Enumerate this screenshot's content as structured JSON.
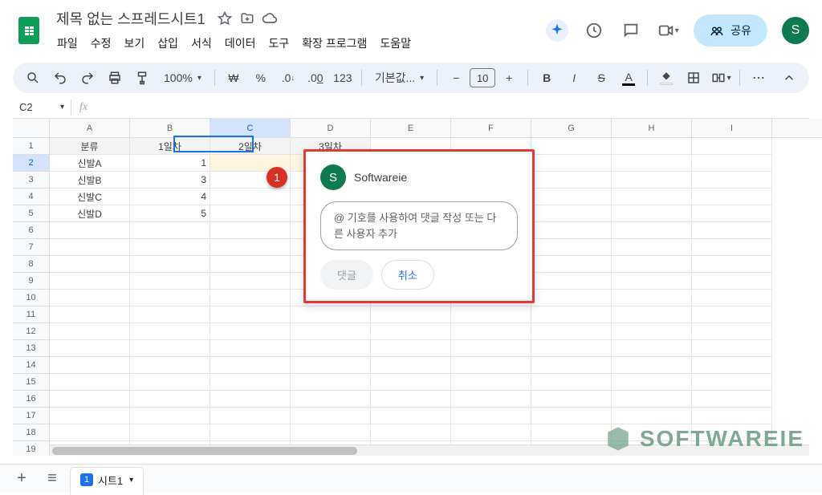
{
  "header": {
    "doc_title": "제목 없는 스프레드시트1",
    "menus": [
      "파일",
      "수정",
      "보기",
      "삽입",
      "서식",
      "데이터",
      "도구",
      "확장 프로그램",
      "도움말"
    ],
    "share_label": "공유",
    "avatar_letter": "S"
  },
  "toolbar": {
    "zoom": "100%",
    "currency": "₩",
    "percent": "%",
    "dec_dec": ".0",
    "inc_dec": ".00",
    "num_fmt": "123",
    "font": "기본값...",
    "font_size": "10"
  },
  "formula_bar": {
    "cell_ref": "C2",
    "fx": "fx",
    "value": ""
  },
  "columns": [
    "A",
    "B",
    "C",
    "D",
    "E",
    "F",
    "G",
    "H",
    "I"
  ],
  "selected_col_index": 2,
  "selected_row_index": 1,
  "row_count": 19,
  "data": [
    [
      "분류",
      "1일차",
      "2일차",
      "3일차"
    ],
    [
      "신발A",
      "1",
      "",
      ""
    ],
    [
      "신발B",
      "3",
      "",
      ""
    ],
    [
      "신발C",
      "4",
      "",
      ""
    ],
    [
      "신발D",
      "5",
      "",
      ""
    ]
  ],
  "comment": {
    "author": "Softwareie",
    "avatar_letter": "S",
    "placeholder": "@ 기호를 사용하여 댓글 작성 또는 다른 사용자 추가",
    "submit": "댓글",
    "cancel": "취소"
  },
  "annotation": {
    "badge": "1"
  },
  "sheet_tabs": {
    "active": "시트1",
    "comment_count": "1"
  },
  "watermark": "SOFTWAREIE"
}
